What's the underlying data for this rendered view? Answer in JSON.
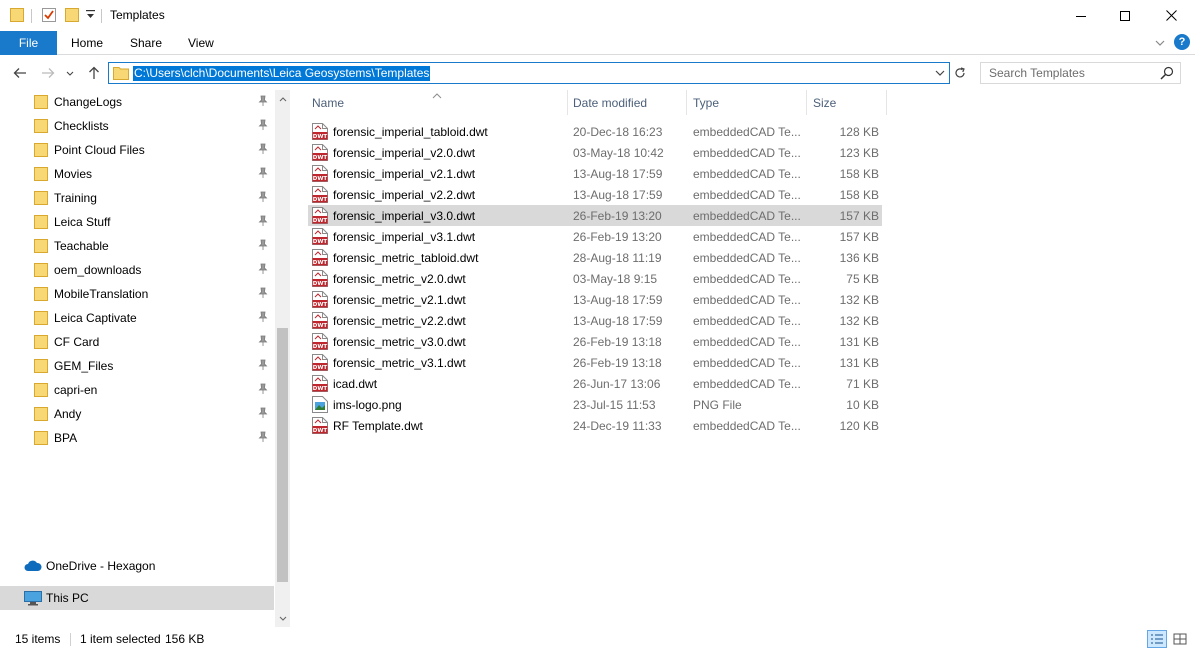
{
  "window": {
    "title": "Templates"
  },
  "icons": {
    "folder": "folder-icon",
    "properties": "properties-icon",
    "new_folder": "new-folder-icon",
    "customize": "customize-quick-access-icon",
    "minimize": "minimize-icon",
    "maximize": "maximize-icon",
    "close": "close-icon",
    "back": "back-arrow-icon",
    "forward": "forward-arrow-icon",
    "recent": "recent-locations-icon",
    "up": "up-arrow-icon",
    "refresh": "refresh-icon",
    "search": "search-icon",
    "pin": "pin-icon",
    "onedrive": "cloud-icon",
    "this_pc": "computer-icon",
    "dwt": "dwt-file-icon",
    "png": "image-file-icon",
    "details_view": "details-view-icon",
    "large_icons_view": "large-icons-view-icon"
  },
  "colors": {
    "accent": "#1979ca",
    "selection": "#0078d7",
    "folder": "#e8b93a",
    "dwt_red": "#c0262d"
  },
  "ribbon": {
    "tabs": [
      {
        "label": "File"
      },
      {
        "label": "Home"
      },
      {
        "label": "Share"
      },
      {
        "label": "View"
      }
    ],
    "help": "?"
  },
  "address": {
    "path": "C:\\Users\\clch\\Documents\\Leica Geosystems\\Templates"
  },
  "search": {
    "placeholder": "Search Templates"
  },
  "sidebar": {
    "quick_access": [
      {
        "label": "ChangeLogs"
      },
      {
        "label": "Checklists"
      },
      {
        "label": "Point Cloud Files"
      },
      {
        "label": "Movies"
      },
      {
        "label": "Training"
      },
      {
        "label": "Leica Stuff"
      },
      {
        "label": "Teachable"
      },
      {
        "label": "oem_downloads"
      },
      {
        "label": "MobileTranslation"
      },
      {
        "label": "Leica Captivate"
      },
      {
        "label": "CF Card"
      },
      {
        "label": "GEM_Files"
      },
      {
        "label": "capri-en"
      },
      {
        "label": "Andy"
      },
      {
        "label": "BPA"
      }
    ],
    "onedrive": "OneDrive - Hexagon",
    "this_pc": "This PC"
  },
  "columns": {
    "name": "Name",
    "date": "Date modified",
    "type": "Type",
    "size": "Size"
  },
  "files": [
    {
      "name": "forensic_imperial_tabloid.dwt",
      "date": "20-Dec-18 16:23",
      "type": "embeddedCAD Te...",
      "size": "128 KB",
      "kind": "dwt"
    },
    {
      "name": "forensic_imperial_v2.0.dwt",
      "date": "03-May-18 10:42",
      "type": "embeddedCAD Te...",
      "size": "123 KB",
      "kind": "dwt"
    },
    {
      "name": "forensic_imperial_v2.1.dwt",
      "date": "13-Aug-18 17:59",
      "type": "embeddedCAD Te...",
      "size": "158 KB",
      "kind": "dwt"
    },
    {
      "name": "forensic_imperial_v2.2.dwt",
      "date": "13-Aug-18 17:59",
      "type": "embeddedCAD Te...",
      "size": "158 KB",
      "kind": "dwt"
    },
    {
      "name": "forensic_imperial_v3.0.dwt",
      "date": "26-Feb-19 13:20",
      "type": "embeddedCAD Te...",
      "size": "157 KB",
      "kind": "dwt",
      "selected": true
    },
    {
      "name": "forensic_imperial_v3.1.dwt",
      "date": "26-Feb-19 13:20",
      "type": "embeddedCAD Te...",
      "size": "157 KB",
      "kind": "dwt"
    },
    {
      "name": "forensic_metric_tabloid.dwt",
      "date": "28-Aug-18 11:19",
      "type": "embeddedCAD Te...",
      "size": "136 KB",
      "kind": "dwt"
    },
    {
      "name": "forensic_metric_v2.0.dwt",
      "date": "03-May-18 9:15",
      "type": "embeddedCAD Te...",
      "size": "75 KB",
      "kind": "dwt"
    },
    {
      "name": "forensic_metric_v2.1.dwt",
      "date": "13-Aug-18 17:59",
      "type": "embeddedCAD Te...",
      "size": "132 KB",
      "kind": "dwt"
    },
    {
      "name": "forensic_metric_v2.2.dwt",
      "date": "13-Aug-18 17:59",
      "type": "embeddedCAD Te...",
      "size": "132 KB",
      "kind": "dwt"
    },
    {
      "name": "forensic_metric_v3.0.dwt",
      "date": "26-Feb-19 13:18",
      "type": "embeddedCAD Te...",
      "size": "131 KB",
      "kind": "dwt"
    },
    {
      "name": "forensic_metric_v3.1.dwt",
      "date": "26-Feb-19 13:18",
      "type": "embeddedCAD Te...",
      "size": "131 KB",
      "kind": "dwt"
    },
    {
      "name": "icad.dwt",
      "date": "26-Jun-17 13:06",
      "type": "embeddedCAD Te...",
      "size": "71 KB",
      "kind": "dwt"
    },
    {
      "name": "ims-logo.png",
      "date": "23-Jul-15 11:53",
      "type": "PNG File",
      "size": "10 KB",
      "kind": "png"
    },
    {
      "name": "RF Template.dwt",
      "date": "24-Dec-19 11:33",
      "type": "embeddedCAD Te...",
      "size": "120 KB",
      "kind": "dwt"
    }
  ],
  "status": {
    "items": "15 items",
    "selection": "1 item selected",
    "size": "156 KB"
  }
}
